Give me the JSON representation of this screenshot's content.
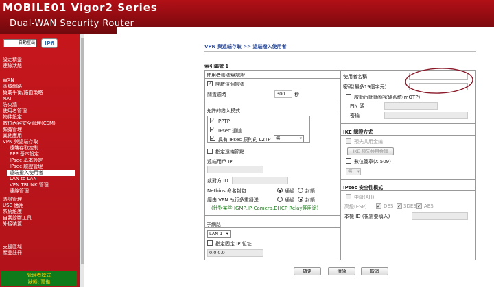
{
  "header": {
    "brand": "MOBILE01 Vigor2",
    "brand_suffix": "Series",
    "model": "Dual-WAN Security Router"
  },
  "top": {
    "auto_logout": "自動登出",
    "ipv6_badge": "IP6"
  },
  "sidebar": {
    "items": [
      "設定精靈",
      "連線狀態",
      "WAN",
      "區域網路",
      "負載平衡/路由策略",
      "NAT",
      "防火牆",
      "使用者管理",
      "物件設定",
      "數位內容安全管理(CSM)",
      "頻寬管理",
      "其他應用",
      "VPN 與遠端存取"
    ],
    "vpn_sub": [
      "遠端存取控制",
      "PPP 基本設定",
      "IPsec 基本設定",
      "IPsec 驗證管理",
      "遠端撥入使用者",
      "LAN to LAN",
      "VPN TRUNK 管理",
      "連線管理"
    ],
    "items2": [
      "憑證管理",
      "USB 應用",
      "系統維護",
      "自我診斷工具",
      "外接裝置"
    ],
    "items3": [
      "支援區域",
      "產品註冊"
    ]
  },
  "status": {
    "line1": "管理者模式",
    "line2": "狀態: 預備"
  },
  "page": {
    "title": "VPN 與遠端存取 >> 遠端撥入使用者",
    "index": "索引編號 1"
  },
  "left": {
    "user_status": "使用者帳號與認證",
    "enable_account": "開啟這個帳號",
    "idle_timeout": "閒置逾時",
    "idle_value": "300",
    "idle_unit": "秒",
    "allowed_modes": "允許的撥入模式",
    "pptp": "PPTP",
    "ipsec": "IPsec 通道",
    "l2tp": "具有 IPsec 原則的 L2TP",
    "l2tp_opt": "無",
    "specify_node": "指定遠端節點",
    "remote_ip_label": "遠端用戶 IP",
    "peer_id": "或對方 ID",
    "netbios": "Netbios 命名封包",
    "pass": "通過",
    "block": "封鎖",
    "multicast": "經由 VPN 執行多重播送",
    "multicast_note": "(針對某些 IGMP,IP-Camera,DHCP Relay等用途)",
    "subnet": "子網路",
    "lan": "LAN 1",
    "fixed_ip": "指定固定 IP 位址",
    "fixed_ip_value": "0.0.0.0"
  },
  "right": {
    "username": "使用者名稱",
    "password": "密碼(最多19個字元)",
    "mOTP": "啟動行動動態密碼系統(mOTP)",
    "pin": "PIN 碼",
    "secret": "密鑰",
    "ike_method": "IKE 認證方式",
    "psk": "預先共用金鑰",
    "ike_btn": "IKE 預先共用金鑰",
    "cert": "數位簽章(X.509)",
    "cert_opt": "無",
    "ipsec_method": "IPsec 安全性模式",
    "medium": "中級(AH)",
    "high": "高級(ESP)",
    "des": "DES",
    "3des": "3DES",
    "aes": "AES",
    "local_id": "本機 ID (視需要填入)"
  },
  "buttons": {
    "ok": "確定",
    "clear": "清除",
    "cancel": "取消"
  },
  "colors": {
    "accent": "#b0131a",
    "status_bg": "#0f7a1a",
    "status_text": "#ffd200"
  }
}
